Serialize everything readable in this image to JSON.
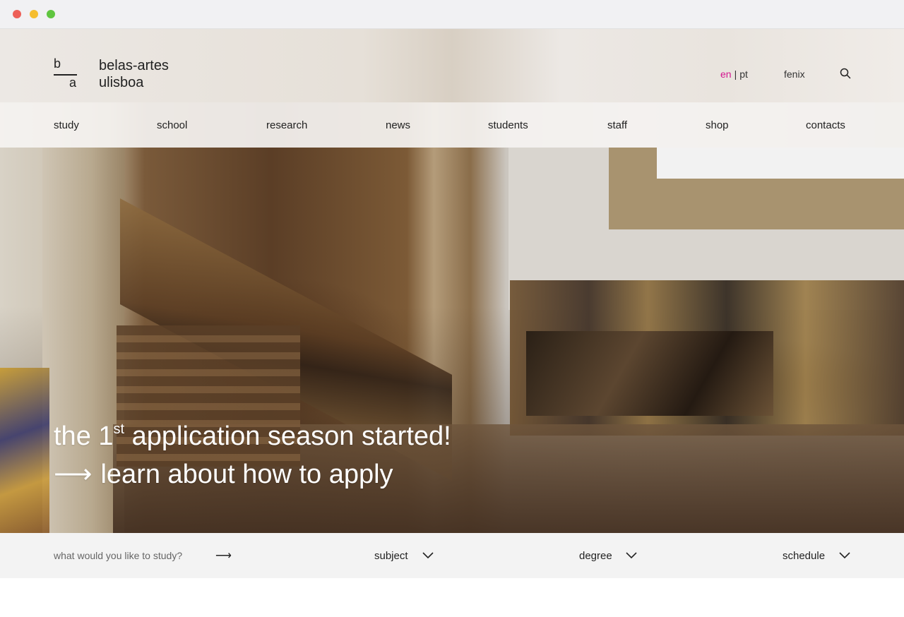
{
  "brand": {
    "logo_top": "b",
    "logo_bottom": "a",
    "name_line1": "belas-artes",
    "name_line2": "ulisboa",
    "accent_color": "#d4148f"
  },
  "header": {
    "lang_active": "en",
    "lang_separator": "|",
    "lang_other": "pt",
    "fenix": "fenix",
    "search_icon": "search-icon"
  },
  "nav": {
    "items": [
      "study",
      "school",
      "research",
      "news",
      "students",
      "staff",
      "shop",
      "contacts"
    ]
  },
  "hero": {
    "headline_pre": "the 1",
    "headline_sup": "st",
    "headline_post": " application season started!",
    "cta_arrow": "⟶",
    "cta_text": "learn about how to apply"
  },
  "study_finder": {
    "prompt": "what would you like to study?",
    "arrow": "⟶",
    "filters": [
      "subject",
      "degree",
      "schedule"
    ]
  }
}
